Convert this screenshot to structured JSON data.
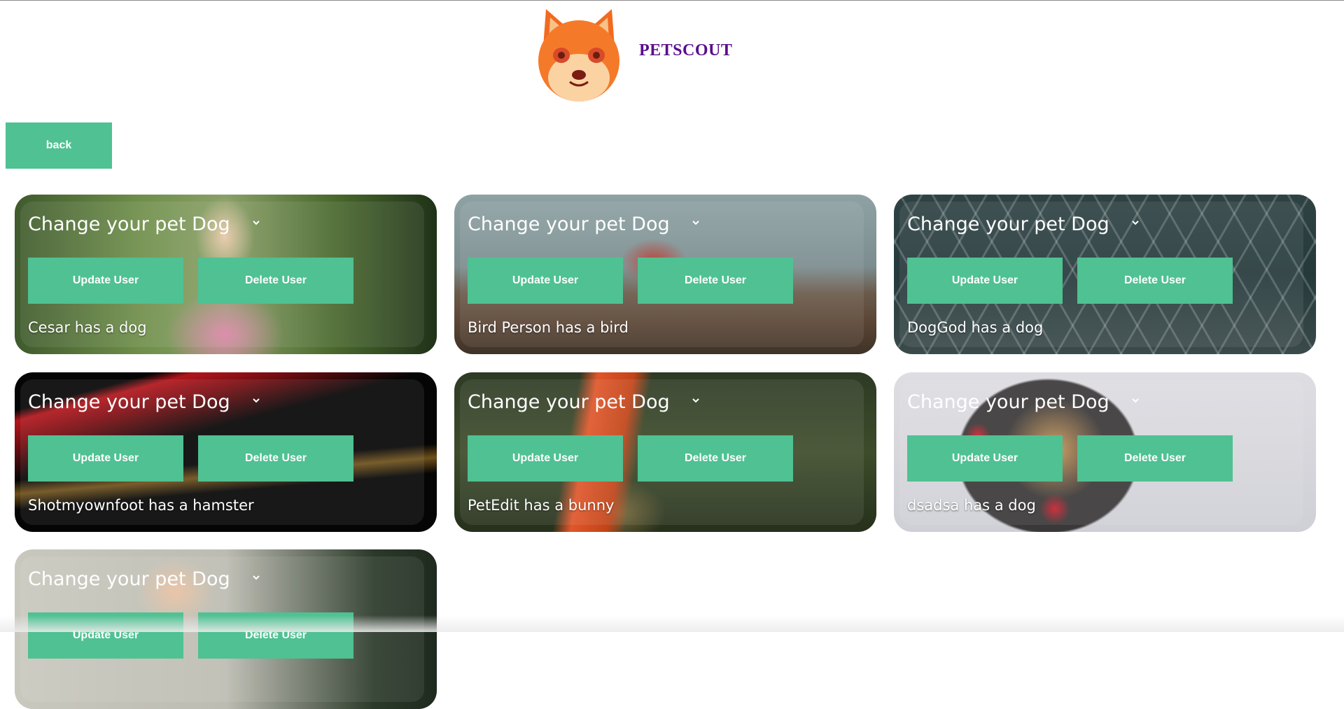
{
  "header": {
    "brand": "PETSCOUT",
    "logo_icon": "shiba-dog-logo"
  },
  "nav": {
    "back_label": "back"
  },
  "colors": {
    "accent": "#4fc192",
    "brand": "#5a0d8c"
  },
  "cards": [
    {
      "select_value": "Change your pet Dog",
      "update_label": "Update User",
      "delete_label": "Delete User",
      "caption": "Cesar has a dog"
    },
    {
      "select_value": "Change your pet Dog",
      "update_label": "Update User",
      "delete_label": "Delete User",
      "caption": "Bird Person has a bird"
    },
    {
      "select_value": "Change your pet Dog",
      "update_label": "Update User",
      "delete_label": "Delete User",
      "caption": "DogGod has a dog"
    },
    {
      "select_value": "Change your pet Dog",
      "update_label": "Update User",
      "delete_label": "Delete User",
      "caption": "Shotmyownfoot has a hamster"
    },
    {
      "select_value": "Change your pet Dog",
      "update_label": "Update User",
      "delete_label": "Delete User",
      "caption": "PetEdit has a bunny"
    },
    {
      "select_value": "Change your pet Dog",
      "update_label": "Update User",
      "delete_label": "Delete User",
      "caption": "dsadsa has a dog"
    },
    {
      "select_value": "Change your pet Dog",
      "update_label": "Update User",
      "delete_label": "Delete User",
      "caption": ""
    }
  ]
}
